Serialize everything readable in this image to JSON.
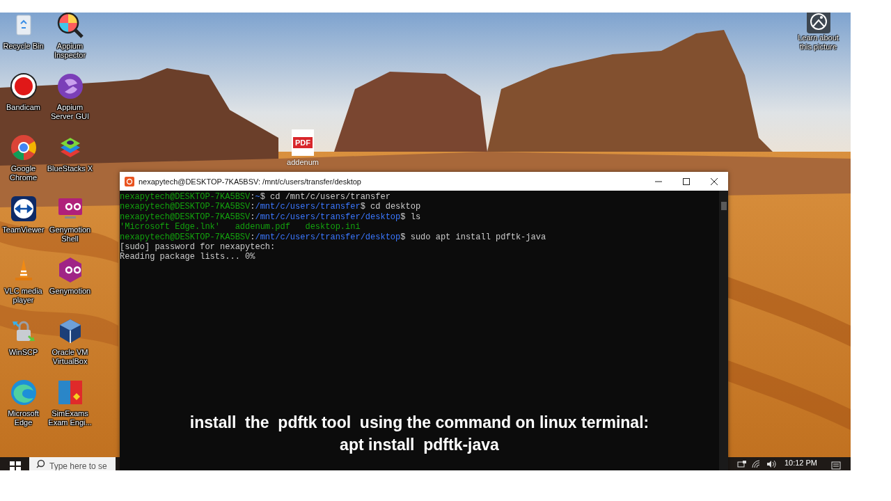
{
  "desktop_icons": [
    {
      "label": "Recycle Bin"
    },
    {
      "label": "Bandicam"
    },
    {
      "label": "Google Chrome"
    },
    {
      "label": "TeamViewer"
    },
    {
      "label": "VLC media player"
    },
    {
      "label": "WinSCP"
    },
    {
      "label": "Microsoft Edge"
    },
    {
      "label": "Appium Inspector"
    },
    {
      "label": "Appium Server GUI"
    },
    {
      "label": "BlueStacks X"
    },
    {
      "label": "Genymotion Shell"
    },
    {
      "label": "Genymotion"
    },
    {
      "label": "Oracle VM VirtualBox"
    },
    {
      "label": "SimExams Exam Engi..."
    }
  ],
  "desktop_file": {
    "badge": "PDF",
    "label": "addenum"
  },
  "spotlight": {
    "label": "Learn about this picture"
  },
  "terminal": {
    "title": "nexapytech@DESKTOP-7KA5BSV: /mnt/c/users/transfer/desktop",
    "lines": [
      {
        "kind": "prompt",
        "user": "nexapytech@DESKTOP-7KA5BSV",
        "separator": ":",
        "path": "~",
        "command": "$ cd /mnt/c/users/transfer"
      },
      {
        "kind": "prompt",
        "user": "nexapytech@DESKTOP-7KA5BSV",
        "separator": ":",
        "path": "/mnt/c/users/transfer",
        "command": "$ cd desktop"
      },
      {
        "kind": "prompt",
        "user": "nexapytech@DESKTOP-7KA5BSV",
        "separator": ":",
        "path": "/mnt/c/users/transfer/desktop",
        "command": "$ ls"
      },
      {
        "kind": "listing",
        "text": "'Microsoft Edge.lnk'   addenum.pdf   desktop.ini"
      },
      {
        "kind": "prompt",
        "user": "nexapytech@DESKTOP-7KA5BSV",
        "separator": ":",
        "path": "/mnt/c/users/transfer/desktop",
        "command": "$ sudo apt install pdftk-java"
      },
      {
        "kind": "output",
        "text": "[sudo] password for nexapytech:"
      },
      {
        "kind": "output",
        "text": "Reading package lists... 0%"
      }
    ],
    "caption": [
      "install  the  pdftk tool  using the command on linux terminal:",
      "apt install  pdftk-java"
    ]
  },
  "taskbar": {
    "search_placeholder": "Type here to se",
    "time": "10:12 PM"
  }
}
